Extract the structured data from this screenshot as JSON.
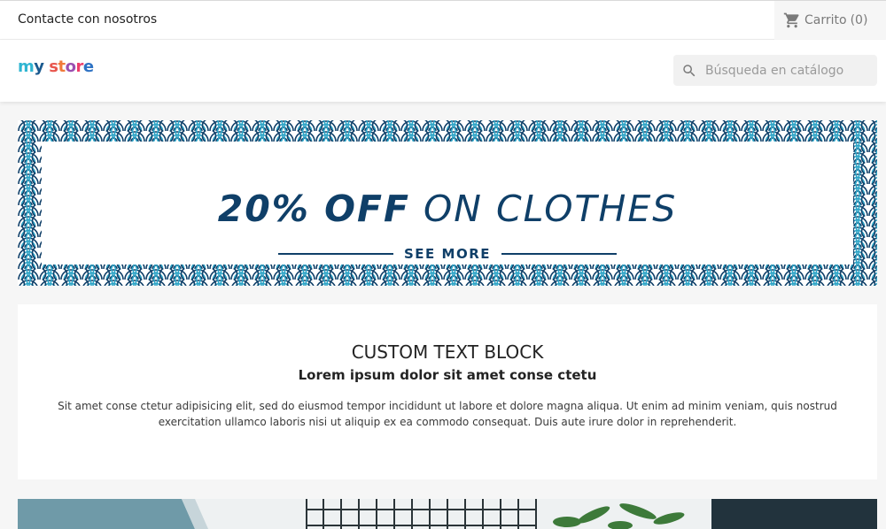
{
  "topnav": {
    "contact_label": "Contacte con nosotros",
    "cart_label": "Carrito",
    "cart_count": "(0)",
    "cart_icon": "shopping-cart-icon"
  },
  "header": {
    "logo_text": "my store",
    "search_placeholder": "Búsqueda en catálogo",
    "search_icon": "search-icon"
  },
  "banner": {
    "title_strong": "20% OFF",
    "title_light": "ON CLOTHES",
    "cta": "SEE MORE",
    "colors": {
      "navy": "#0f3f68",
      "teal": "#2aa3c6",
      "white": "#ffffff"
    }
  },
  "custom_text": {
    "title": "CUSTOM TEXT BLOCK",
    "subtitle": "Lorem ipsum dolor sit amet conse ctetu",
    "body": "Sit amet conse ctetur adipisicing elit, sed do eiusmod tempor incididunt ut labore et dolore magna aliqua. Ut enim ad minim veniam, quis nostrud exercitation ullamco laboris nisi ut aliquip ex ea commodo consequat. Duis aute irure dolor in reprehenderit."
  },
  "colors": {
    "brand_blue": "#2fb5d2",
    "text": "#232323",
    "muted": "#7a7a7a",
    "background": "#f6f6f6"
  }
}
